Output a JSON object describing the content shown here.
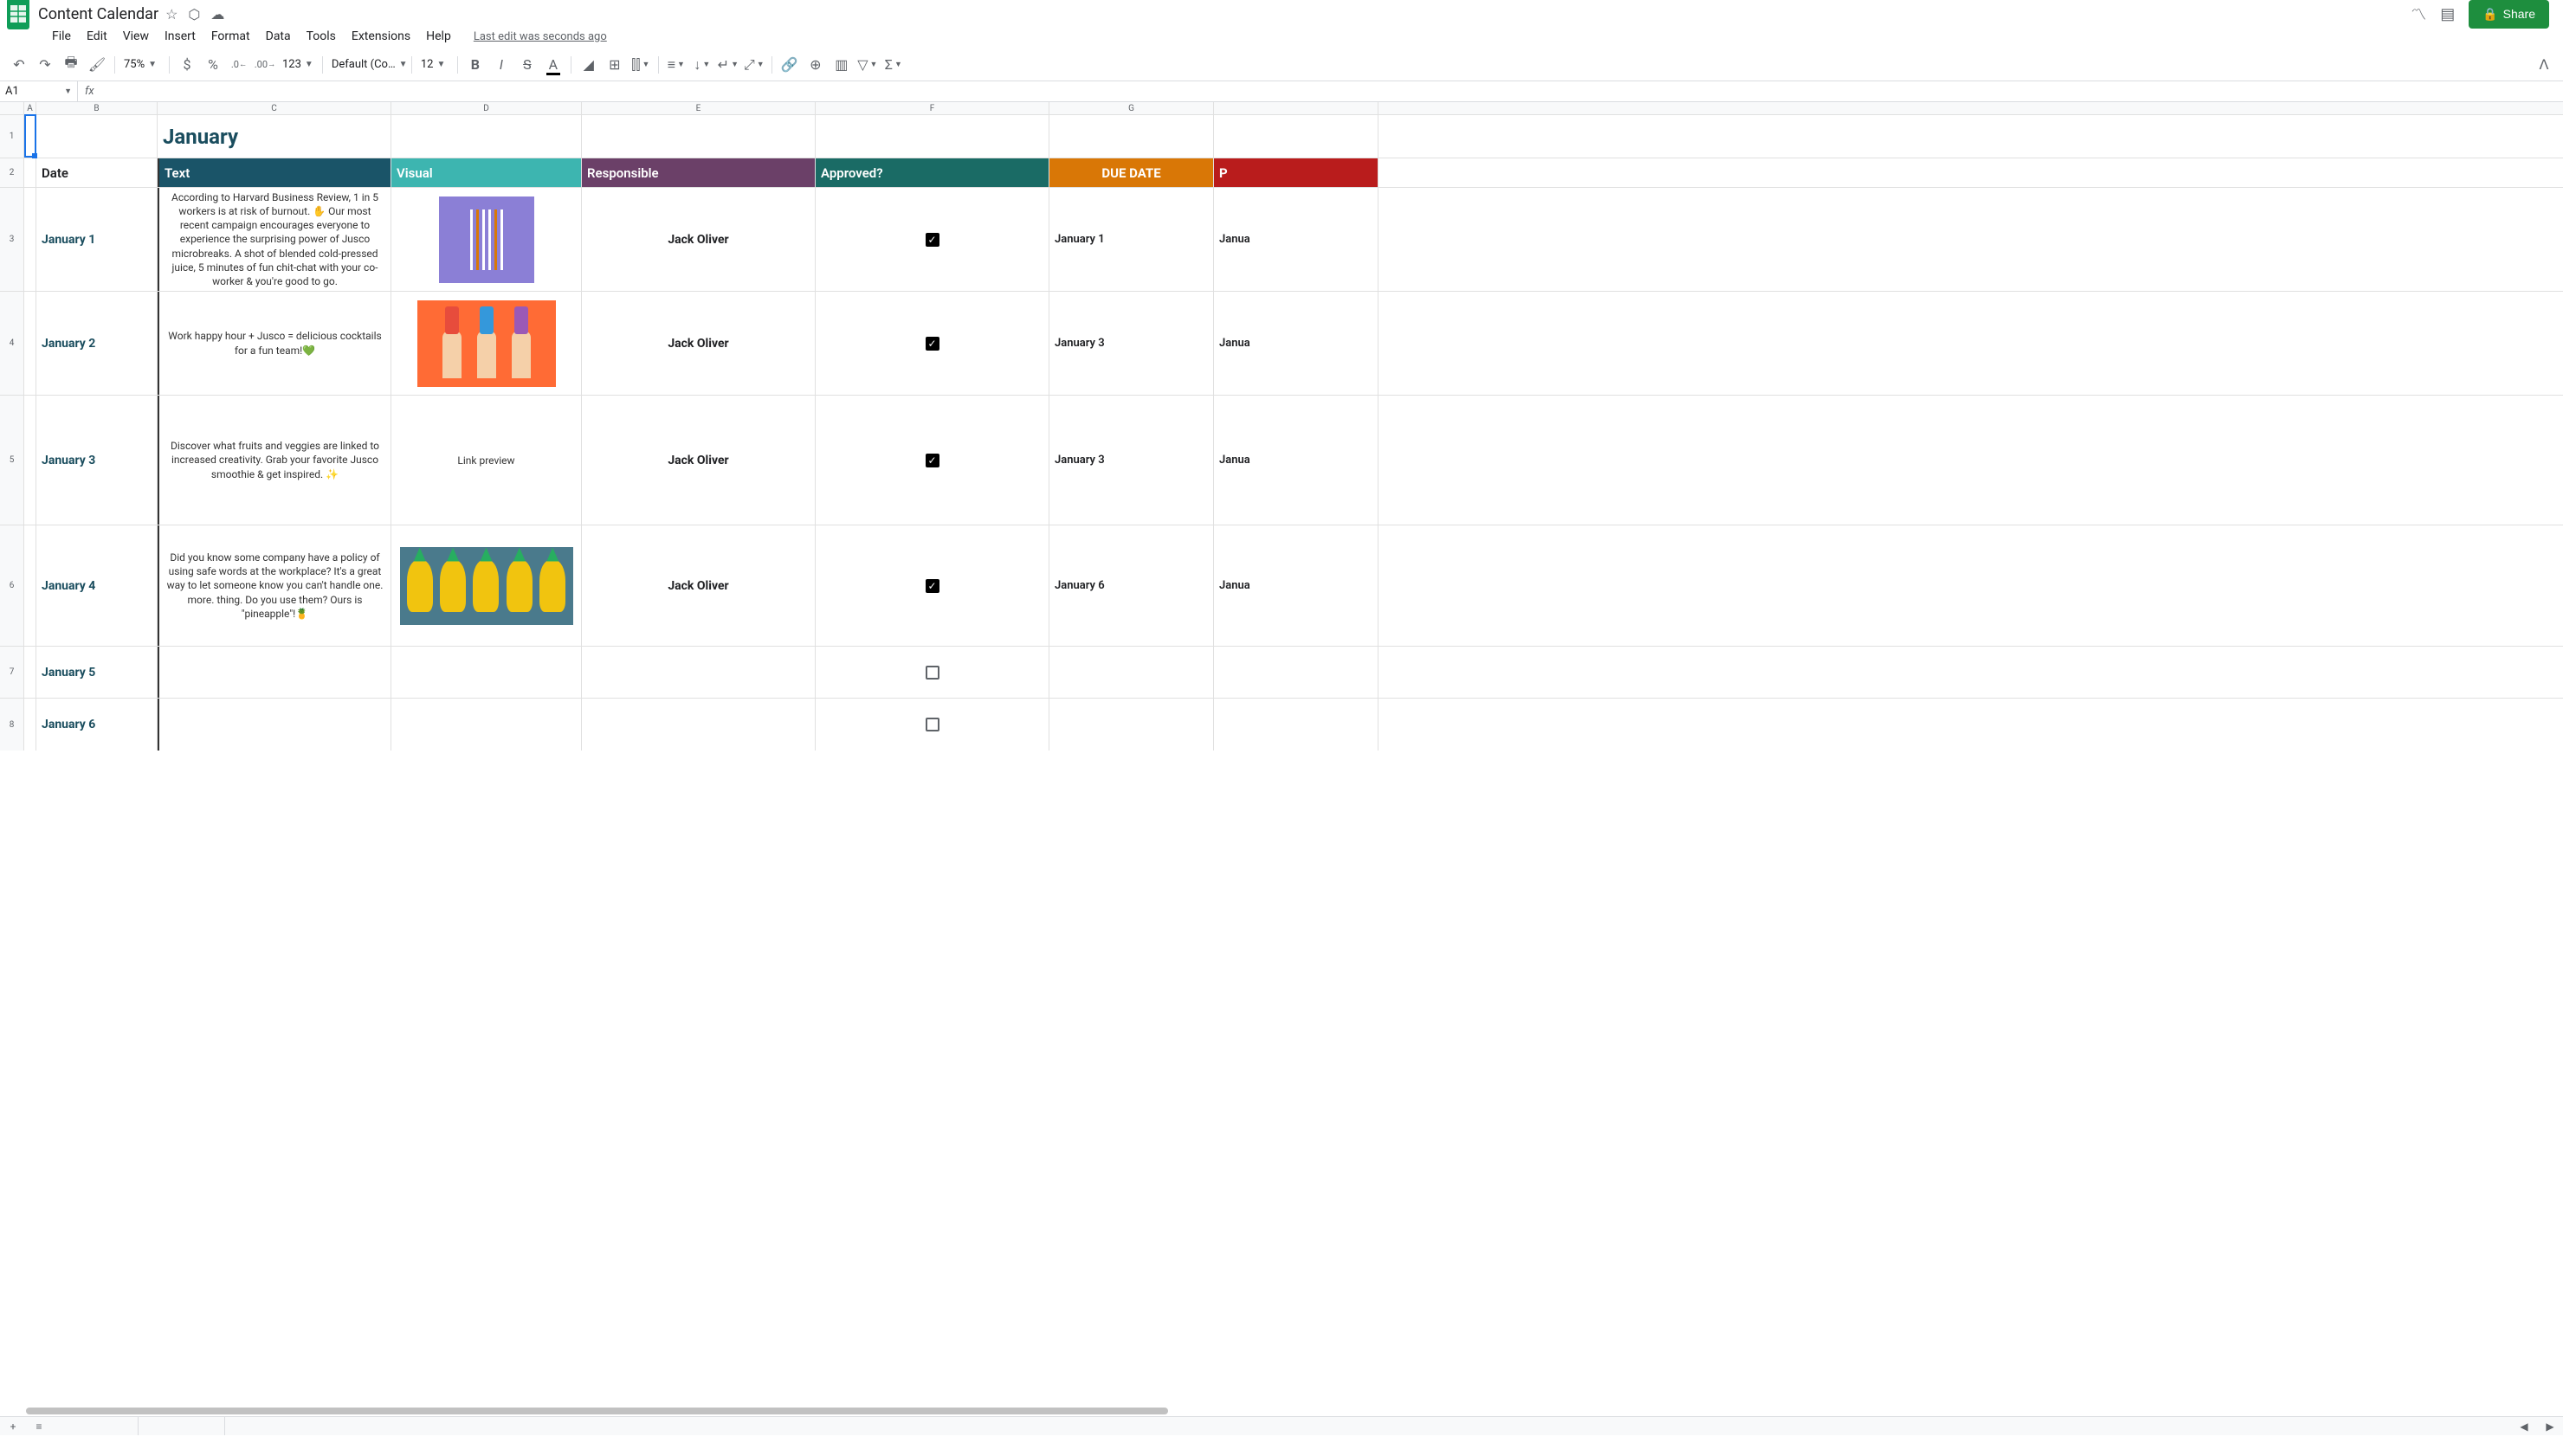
{
  "doc": {
    "title": "Content Calendar",
    "last_edit": "Last edit was seconds ago"
  },
  "menu": {
    "file": "File",
    "edit": "Edit",
    "view": "View",
    "insert": "Insert",
    "format": "Format",
    "data": "Data",
    "tools": "Tools",
    "extensions": "Extensions",
    "help": "Help"
  },
  "toolbar": {
    "zoom": "75%",
    "font": "Default (Co…",
    "size": "12",
    "format123": "123"
  },
  "share": "Share",
  "name_box": "A1",
  "columns": {
    "A": "A",
    "B": "B",
    "C": "C",
    "D": "D",
    "E": "E",
    "F": "F",
    "G": "G"
  },
  "rownums": {
    "r1": "1",
    "r2": "2",
    "r3": "3",
    "r4": "4",
    "r5": "5",
    "r6": "6",
    "r7": "7",
    "r8": "8"
  },
  "sheet": {
    "month": "January",
    "headers": {
      "date": "Date",
      "text": "Text",
      "visual": "Visual",
      "responsible": "Responsible",
      "approved": "Approved?",
      "due": "DUE DATE",
      "p": "P"
    },
    "rows": [
      {
        "date": "January 1",
        "text": "According to Harvard Business Review, 1 in 5 workers is at risk of burnout. ✋ Our most recent campaign encourages everyone to experience the surprising power of Jusco microbreaks. A shot of blended cold-pressed juice, 5 minutes of fun chit-chat with your co-worker & you're good to go.",
        "visual": "straws",
        "responsible": "Jack Oliver",
        "approved": true,
        "due": "January 1",
        "partial": "Janua"
      },
      {
        "date": "January 2",
        "text": "Work happy hour + Jusco = delicious cocktails for a fun team!💚",
        "visual": "hands",
        "responsible": "Jack Oliver",
        "approved": true,
        "due": "January 3",
        "partial": "Janua"
      },
      {
        "date": "January 3",
        "text": "Discover what fruits and veggies are linked to increased creativity. Grab your favorite Jusco smoothie & get inspired. ✨",
        "visual": "link",
        "visual_text": "Link preview",
        "responsible": "Jack Oliver",
        "approved": true,
        "due": "January 3",
        "partial": "Janua"
      },
      {
        "date": "January 4",
        "text": "Did you know some company have a policy of using safe words at the workplace? It's a great way to let someone know you can't handle one. more. thing. Do you use them? Ours is \"pineapple\"!🍍",
        "visual": "pineapple",
        "responsible": "Jack Oliver",
        "approved": true,
        "due": "January 6",
        "partial": "Janua"
      },
      {
        "date": "January 5",
        "text": "",
        "visual": "",
        "responsible": "",
        "approved": false,
        "due": "",
        "partial": ""
      },
      {
        "date": "January 6",
        "text": "",
        "visual": "",
        "responsible": "",
        "approved": false,
        "due": "",
        "partial": ""
      }
    ]
  }
}
